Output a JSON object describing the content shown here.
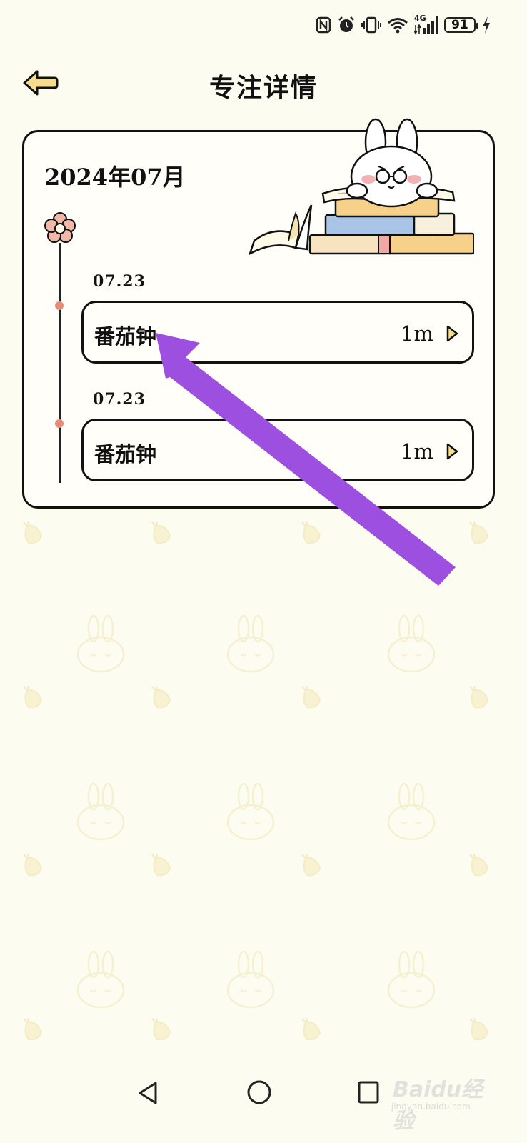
{
  "status_bar": {
    "network": "4G",
    "battery_level": "91"
  },
  "header": {
    "title": "专注详情"
  },
  "card": {
    "month": "2024年07月",
    "entries": [
      {
        "date": "07.23",
        "name": "番茄钟",
        "duration": "1m"
      },
      {
        "date": "07.23",
        "name": "番茄钟",
        "duration": "1m"
      }
    ]
  },
  "watermark": {
    "brand": "Baidu经验",
    "url": "jingyan.baidu.com"
  },
  "colors": {
    "background": "#fdfcf1",
    "accent_yellow": "#f6dd8e",
    "timeline_dot": "#e58b76",
    "annotation_arrow": "#9d4fe0"
  },
  "icons": {
    "back": "arrow-left-icon",
    "entry_chevron": "play-triangle-icon",
    "timeline_head": "flower-icon",
    "nav": [
      "nav-back-icon",
      "nav-home-icon",
      "nav-recents-icon"
    ]
  }
}
